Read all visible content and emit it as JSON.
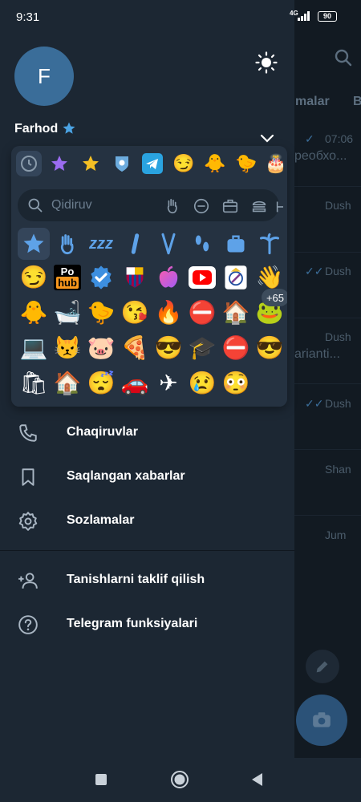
{
  "status_bar": {
    "time": "9:31",
    "network": "4G",
    "battery": "90"
  },
  "background_chats": {
    "tab_partial_1": "malar",
    "tab_partial_2": "B",
    "items": [
      {
        "time": "07:06",
        "preview": "реобхо...",
        "checks": "✓"
      },
      {
        "time": "Dush",
        "preview": "",
        "checks": ""
      },
      {
        "time": "Dush",
        "preview": "",
        "checks": "✓✓"
      },
      {
        "time": "Dush",
        "preview": "arianti...",
        "checks": ""
      },
      {
        "time": "Dush",
        "preview": "",
        "checks": "✓✓"
      },
      {
        "time": "Shan",
        "preview": "",
        "checks": ""
      },
      {
        "time": "Jum",
        "preview": "",
        "checks": ""
      }
    ]
  },
  "drawer": {
    "avatar_letter": "F",
    "username": "Farhod",
    "accent_color": "#3a6d99"
  },
  "emoji_popup": {
    "search_placeholder": "Qidiruv",
    "tabs": [
      "clock-icon",
      "purple-star",
      "gold-star",
      "city-badge",
      "telegram-plane",
      "troll-face",
      "duck-add",
      "duck-add-2",
      "birthday-add"
    ],
    "rows": [
      [
        "⭐",
        "👋",
        "💤",
        "❘",
        "🍴",
        "👣",
        "💼",
        "🌴"
      ],
      [
        "😏",
        "PH",
        "✅",
        "🟥",
        "🍎",
        "▶",
        "⚽",
        "👋"
      ],
      [
        "🐥",
        "🛁",
        "🐤",
        "😘",
        "🔥",
        "⛔",
        "🏠",
        "🐸"
      ],
      [
        "💻",
        "😾",
        "🐷",
        "🍕",
        "😎",
        "🎓",
        "⛔",
        "😎"
      ],
      [
        "🛍",
        "🏠",
        "😴",
        "🚗",
        "✈",
        "😢",
        "😳",
        ""
      ]
    ],
    "more_count": "+65"
  },
  "menu": {
    "items": [
      {
        "label": "Chaqiruvlar",
        "icon": "phone-icon"
      },
      {
        "label": "Saqlangan xabarlar",
        "icon": "bookmark-icon"
      },
      {
        "label": "Sozlamalar",
        "icon": "gear-icon"
      },
      {
        "label": "Tanishlarni taklif qilish",
        "icon": "add-user-icon"
      },
      {
        "label": "Telegram funksiyalari",
        "icon": "help-icon"
      }
    ]
  }
}
